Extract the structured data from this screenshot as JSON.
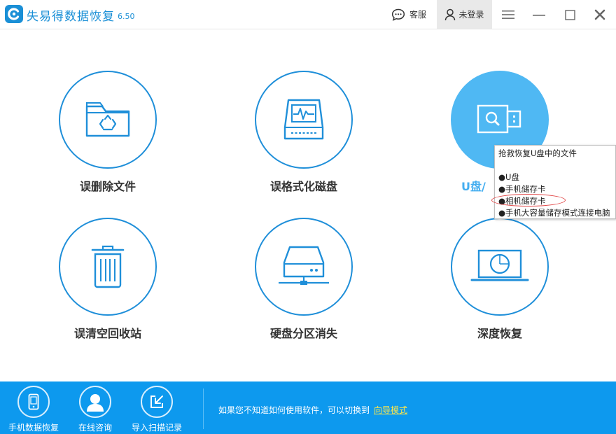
{
  "app": {
    "title": "失易得数据恢复",
    "version": "6.50"
  },
  "header": {
    "service_label": "客服",
    "login_label": "未登录"
  },
  "tiles": [
    {
      "label": "误删除文件"
    },
    {
      "label": "误格式化磁盘"
    },
    {
      "label": "U盘/"
    },
    {
      "label": "误清空回收站"
    },
    {
      "label": "硬盘分区消失"
    },
    {
      "label": "深度恢复"
    }
  ],
  "tooltip": {
    "title": "抢救恢复U盘中的文件",
    "items": [
      "●U盘",
      "●手机储存卡",
      "●相机储存卡",
      "●手机大容量储存模式连接电脑"
    ]
  },
  "footer": {
    "buttons": [
      {
        "label": "手机数据恢复"
      },
      {
        "label": "在线咨询"
      },
      {
        "label": "导入扫描记录"
      }
    ],
    "hint": "如果您不知道如何使用软件，可以切换到",
    "link": "向导模式"
  },
  "colors": {
    "accent": "#1f8fd9",
    "footer": "#0d99ee",
    "active_tile": "#4fb8f3",
    "link": "#ffe74a",
    "annotation": "#e24b4b"
  }
}
